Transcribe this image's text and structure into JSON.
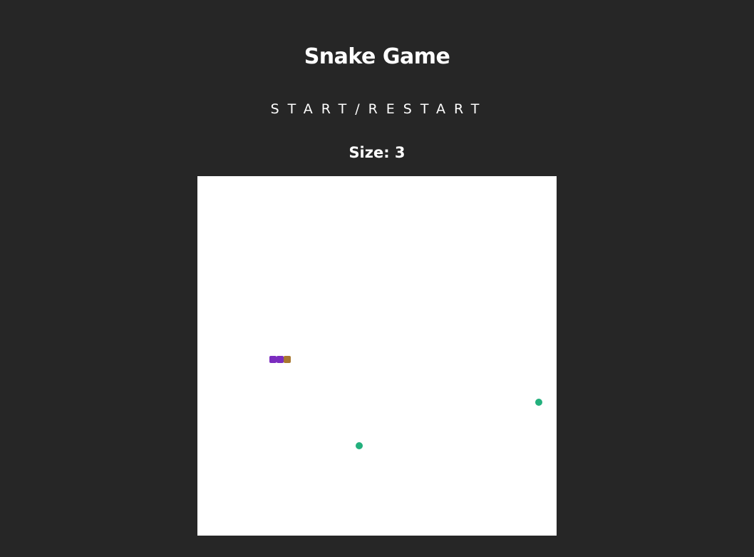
{
  "title": "Snake Game",
  "start_button_label": "START/RESTART",
  "size": {
    "label": "Size: 3",
    "value": 3
  },
  "colors": {
    "page_background": "#262626",
    "board_background": "#ffffff",
    "snake_body": "#7b2cbf",
    "snake_head": "#a8772f",
    "food": "#23b07d"
  },
  "game": {
    "grid_cells": 50,
    "snake": [
      {
        "col": 10,
        "row": 25,
        "part": "body"
      },
      {
        "col": 11,
        "row": 25,
        "part": "body"
      },
      {
        "col": 12,
        "row": 25,
        "part": "head"
      }
    ],
    "food": [
      {
        "col": 22,
        "row": 37
      },
      {
        "col": 47,
        "row": 31
      }
    ]
  }
}
